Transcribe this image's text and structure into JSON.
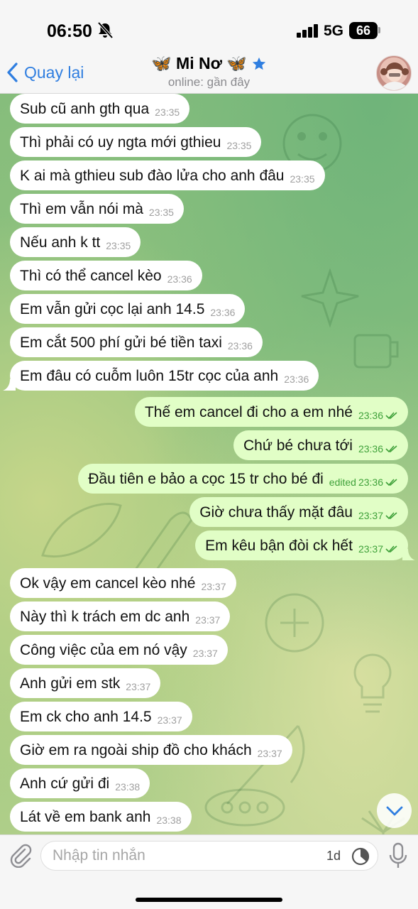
{
  "status_bar": {
    "time": "06:50",
    "network": "5G",
    "battery": "66"
  },
  "header": {
    "back_label": "Quay lại",
    "chat_name": "Mi Nơ",
    "name_emoji_left": "🦋",
    "name_emoji_right": "🦋",
    "status": "online: gần đây"
  },
  "messages": [
    {
      "dir": "in",
      "text": "Sub cũ anh gth qua",
      "time": "23:35"
    },
    {
      "dir": "in",
      "text": "Thì phải có uy ngta mới gthieu",
      "time": "23:35"
    },
    {
      "dir": "in",
      "text": "K ai mà gthieu sub đào lửa cho anh đâu",
      "time": "23:35"
    },
    {
      "dir": "in",
      "text": "Thì em vẫn nói mà",
      "time": "23:35"
    },
    {
      "dir": "in",
      "text": "Nếu anh k tt",
      "time": "23:35"
    },
    {
      "dir": "in",
      "text": "Thì có thể cancel kèo",
      "time": "23:36"
    },
    {
      "dir": "in",
      "text": "Em vẫn gửi cọc lại anh 14.5",
      "time": "23:36"
    },
    {
      "dir": "in",
      "text": "Em cắt 500 phí gửi bé tiền taxi",
      "time": "23:36"
    },
    {
      "dir": "in",
      "text": "Em đâu có cuỗm luôn 15tr cọc của anh",
      "time": "23:36",
      "tail": true
    },
    {
      "dir": "out",
      "text": "Thế em cancel đi cho a em nhé",
      "time": "23:36"
    },
    {
      "dir": "out",
      "text": "Chứ bé chưa tới",
      "time": "23:36"
    },
    {
      "dir": "out",
      "text": "Đầu tiên e bảo a cọc 15 tr cho bé đi",
      "time": "23:36",
      "edited": "edited"
    },
    {
      "dir": "out",
      "text": "Giờ chưa thấy mặt đâu",
      "time": "23:37"
    },
    {
      "dir": "out",
      "text": "Em kêu bận đòi ck hết",
      "time": "23:37",
      "tail": true
    },
    {
      "dir": "in",
      "text": "Ok vậy em cancel kèo nhé",
      "time": "23:37"
    },
    {
      "dir": "in",
      "text": "Này thì k trách em dc anh",
      "time": "23:37"
    },
    {
      "dir": "in",
      "text": "Công việc của em nó vậy",
      "time": "23:37"
    },
    {
      "dir": "in",
      "text": "Anh gửi em stk",
      "time": "23:37"
    },
    {
      "dir": "in",
      "text": "Em ck cho anh 14.5",
      "time": "23:37"
    },
    {
      "dir": "in",
      "text": "Giờ em ra ngoài ship đồ cho khách",
      "time": "23:37"
    },
    {
      "dir": "in",
      "text": "Anh cứ gửi đi",
      "time": "23:38"
    },
    {
      "dir": "in",
      "text": "Lát về em bank anh",
      "time": "23:38"
    }
  ],
  "input": {
    "placeholder": "Nhập tin nhắn",
    "timer_label": "1d"
  },
  "colors": {
    "accent": "#2f7ee0",
    "outgoing_bubble": "#e1fec6",
    "incoming_bubble": "#ffffff",
    "read_ticks": "#3fa13a"
  },
  "icons": {
    "back": "chevron-left-icon",
    "mute": "bell-slash-icon",
    "verified": "star-icon",
    "scroll": "chevron-down-icon",
    "attach": "paperclip-icon",
    "timer": "timer-icon",
    "mic": "microphone-icon"
  }
}
